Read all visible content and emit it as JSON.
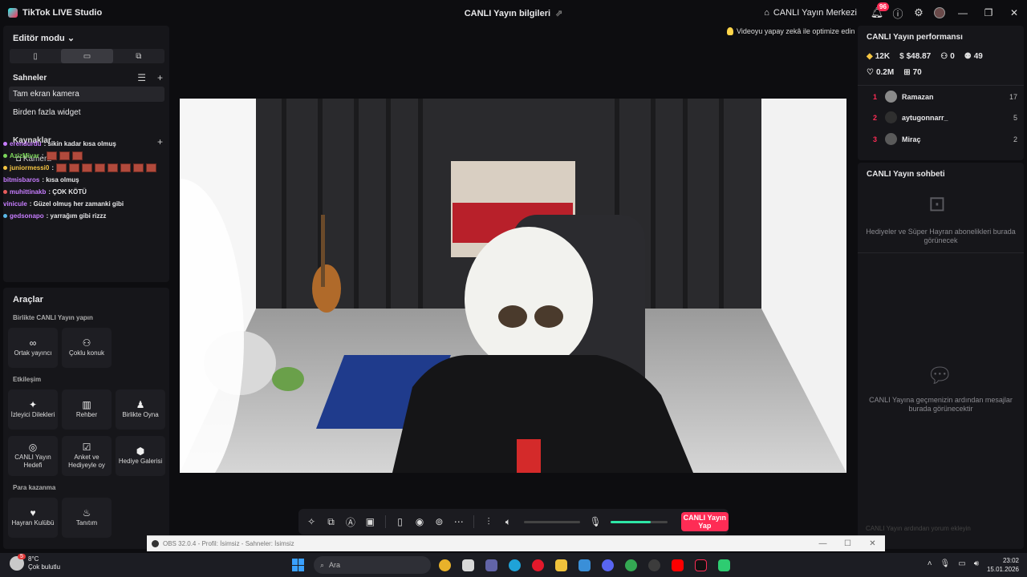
{
  "app": {
    "title": "TikTok LIVE Studio",
    "window_title": "CANLI Yayın bilgileri",
    "live_center": "CANLI Yayın Merkezi",
    "notification_count": "96"
  },
  "left": {
    "editor_mode": "Editör modu",
    "scenes_title": "Sahneler",
    "scenes": [
      "Tam ekran kamera",
      "Birden fazla widget"
    ],
    "sources_title": "Kaynaklar",
    "camera_source": "Kamera"
  },
  "chat_overlay": [
    {
      "user": "erendurdu",
      "msg": ": sikin kadar kısa olmuş",
      "color": "#c77dff"
    },
    {
      "user": "AzizMivar",
      "msg": ":",
      "color": "#7cd65a"
    },
    {
      "user": "juniormessi0",
      "msg": ":",
      "color": "#f5c542"
    },
    {
      "user": "bitmisbaros",
      "msg": ": kısa olmuş",
      "color": "#c77dff"
    },
    {
      "user": "muhittinakb",
      "msg": ": ÇOK KÖTÜ",
      "color": "#c77dff"
    },
    {
      "user": "vinicule",
      "msg": ": Güzel olmuş her zamanki gibi",
      "color": "#c77dff"
    },
    {
      "user": "gedsonapo",
      "msg": ": yarrağım gibi rizzz",
      "color": "#c77dff"
    }
  ],
  "tools": {
    "title": "Araçlar",
    "group_together": "Birlikte CANLI Yayın yapın",
    "cohost": "Ortak yayıncı",
    "multiguest": "Çoklu konuk",
    "group_engagement": "Etkileşim",
    "viewer_wishes": "İzleyici Dilekleri",
    "guide": "Rehber",
    "play_together": "Birlikte Oyna",
    "live_goal": "CANLI Yayın Hedefi",
    "poll": "Anket ve Hediyeyle oy",
    "gift_gallery": "Hediye Galerisi",
    "group_monetize": "Para kazanma",
    "fan_club": "Hayran Kulübü",
    "promote": "Tanıtım"
  },
  "center": {
    "ai_hint": "Videoyu yapay zekâ ile optimize edin",
    "go_live": "CANLI Yayın Yap",
    "mic_level": 0.7
  },
  "right": {
    "perf_title": "CANLI Yayın performansı",
    "diamonds": "12K",
    "earnings": "$48.87",
    "viewers": "0",
    "followers": "49",
    "likes": "0.2M",
    "gifts": "70",
    "top_gifters": [
      {
        "rank": "1",
        "name": "Ramazan",
        "count": "17"
      },
      {
        "rank": "2",
        "name": "aytugonnarr_",
        "count": "5"
      },
      {
        "rank": "3",
        "name": "Miraç",
        "count": "2"
      }
    ],
    "chat_title": "CANLI Yayın sohbeti",
    "gifts_empty": "Hediyeler ve Süper Hayran abonelikleri burada görünecek",
    "chat_empty": "CANLI Yayına geçmenizin ardından mesajlar burada görünecektir",
    "chat_placeholder": "CANLI Yayın ardından yorum ekleyin"
  },
  "obs": {
    "title": "OBS 32.0.4 - Profil: İsimsiz - Sahneler: İsimsiz"
  },
  "taskbar": {
    "temp": "8°C",
    "weather": "Çok bulutlu",
    "weather_badge": "5",
    "search": "Ara",
    "time": "23:02",
    "date": "15.01.2026"
  }
}
